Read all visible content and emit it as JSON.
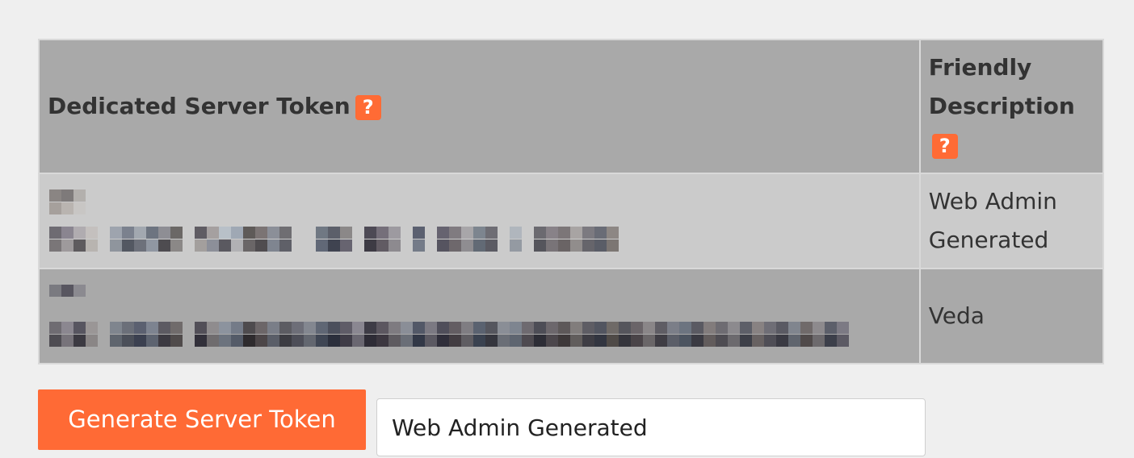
{
  "table": {
    "headers": {
      "token": "Dedicated Server Token",
      "description": "Friendly Description",
      "help_glyph": "?"
    },
    "rows": [
      {
        "token_obscured": true,
        "description": "Web Admin Generated"
      },
      {
        "token_obscured": true,
        "description": "Veda"
      }
    ]
  },
  "actions": {
    "generate_label": "Generate Server Token",
    "description_input_value": "Web Admin Generated"
  },
  "colors": {
    "accent": "#ff6a35",
    "header_bg": "#a9a9a9",
    "row_light_bg": "#cbcbcb",
    "page_bg": "#efefef"
  },
  "icons": {
    "help": "question-mark-icon"
  }
}
